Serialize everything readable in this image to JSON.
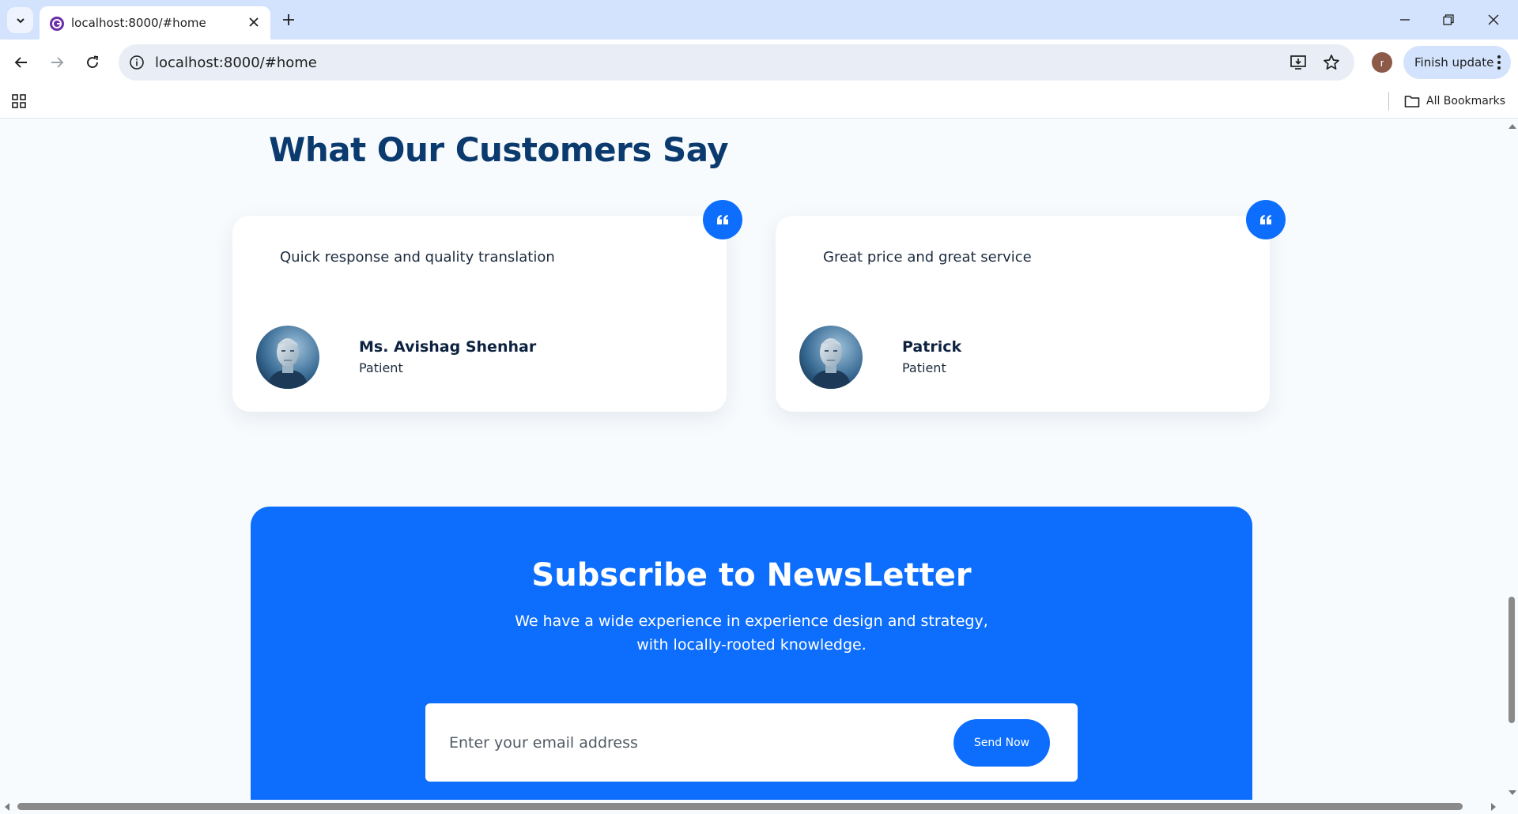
{
  "browser": {
    "tab_title": "localhost:8000/#home",
    "url": "localhost:8000/#home",
    "profile_initial": "r",
    "finish_update_label": "Finish update",
    "all_bookmarks_label": "All Bookmarks"
  },
  "testimonials": {
    "title": "What Our Customers Say",
    "items": [
      {
        "review": "Quick response and quality translation",
        "name": "Ms. Avishag Shenhar",
        "role": "Patient"
      },
      {
        "review": "Great price and great service",
        "name": "Patrick",
        "role": "Patient"
      }
    ]
  },
  "newsletter": {
    "title": "Subscribe to NewsLetter",
    "desc_line1": "We have a wide experience in experience design and strategy,",
    "desc_line2": "with locally-rooted knowledge.",
    "email_placeholder": "Enter your email address",
    "send_label": "Send Now"
  },
  "colors": {
    "primary": "#0d6efd",
    "heading": "#0b3a6e",
    "page_bg": "#f8fbfd"
  }
}
